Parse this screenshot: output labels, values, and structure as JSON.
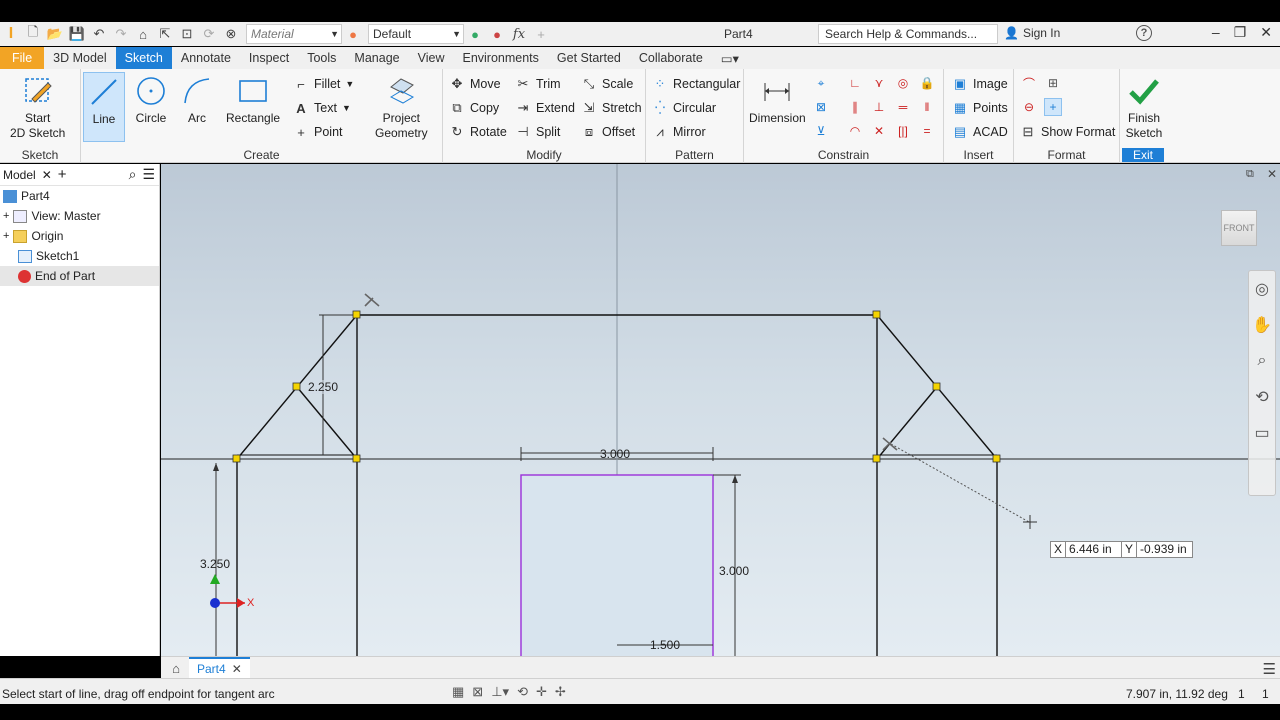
{
  "app": {
    "doc_title": "Part4"
  },
  "qat": {
    "material_placeholder": "Material",
    "appearance_value": "Default",
    "search_placeholder": "Search Help & Commands...",
    "sign_in": "Sign In"
  },
  "tabs": [
    "File",
    "3D Model",
    "Sketch",
    "Annotate",
    "Inspect",
    "Tools",
    "Manage",
    "View",
    "Environments",
    "Get Started",
    "Collaborate"
  ],
  "active_tab": "Sketch",
  "ribbon": {
    "sketch_panel": {
      "start_sketch": "Start",
      "start_sketch2": "2D Sketch",
      "label": "Sketch"
    },
    "create_panel": {
      "line": "Line",
      "circle": "Circle",
      "arc": "Arc",
      "rectangle": "Rectangle",
      "fillet": "Fillet",
      "text": "Text",
      "point": "Point",
      "project": "Project",
      "geometry": "Geometry",
      "label": "Create"
    },
    "modify_panel": {
      "move": "Move",
      "copy": "Copy",
      "rotate": "Rotate",
      "trim": "Trim",
      "extend": "Extend",
      "split": "Split",
      "scale": "Scale",
      "stretch": "Stretch",
      "offset": "Offset",
      "label": "Modify"
    },
    "pattern_panel": {
      "rectangular": "Rectangular",
      "circular": "Circular",
      "mirror": "Mirror",
      "label": "Pattern"
    },
    "constrain_panel": {
      "dimension": "Dimension",
      "label": "Constrain"
    },
    "insert_panel": {
      "image": "Image",
      "points": "Points",
      "acad": "ACAD",
      "label": "Insert"
    },
    "format_panel": {
      "show_format": "Show Format",
      "label": "Format"
    },
    "exit_panel": {
      "finish": "Finish",
      "sketch": "Sketch",
      "label": "Exit"
    }
  },
  "browser": {
    "tab_label": "Model",
    "items": [
      {
        "label": "Part4"
      },
      {
        "label": "View: Master"
      },
      {
        "label": "Origin"
      },
      {
        "label": "Sketch1"
      },
      {
        "label": "End of Part"
      }
    ]
  },
  "sketch": {
    "dims": {
      "d_2250": "2.250",
      "d_3000a": "3.000",
      "d_3000b": "3.000",
      "d_3250": "3.250",
      "d_1500": "1.500"
    },
    "axis_x": "X"
  },
  "viewcube": "FRONT",
  "coord_input": {
    "x_label": "X",
    "x_value": "6.446 in",
    "y_label": "Y",
    "y_value": "-0.939 in"
  },
  "doc_tab": "Part4",
  "status": {
    "prompt": "Select start of line, drag off endpoint for tangent arc",
    "coords": "7.907 in, 11.92 deg",
    "n1": "1",
    "n2": "1"
  },
  "colors": {
    "accent": "#1e7fd6",
    "file_tab": "#f2a425",
    "finish_check": "#22a045",
    "sketch_point": "#f5d400",
    "selection": "#9b30d9"
  }
}
